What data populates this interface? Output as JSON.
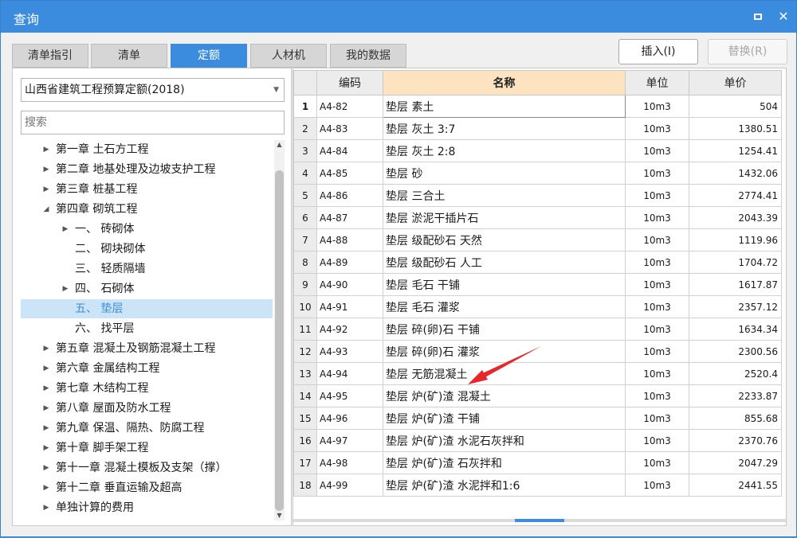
{
  "window": {
    "title": "查询",
    "maximize_label": "",
    "close_label": "✕"
  },
  "tabs": [
    {
      "label": "清单指引",
      "active": false
    },
    {
      "label": "清单",
      "active": false
    },
    {
      "label": "定额",
      "active": true
    },
    {
      "label": "人材机",
      "active": false
    },
    {
      "label": "我的数据",
      "active": false
    }
  ],
  "buttons": {
    "insert": "插入(I)",
    "replace": "替换(R)"
  },
  "left": {
    "dropdown_value": "山西省建筑工程预算定额(2018)",
    "search_placeholder": "搜索",
    "tree": [
      {
        "label": "第一章 土石方工程",
        "level": 0,
        "caret": "▶"
      },
      {
        "label": "第二章 地基处理及边坡支护工程",
        "level": 0,
        "caret": "▶"
      },
      {
        "label": "第三章 桩基工程",
        "level": 0,
        "caret": "▶"
      },
      {
        "label": "第四章 砌筑工程",
        "level": 0,
        "caret": "◢"
      },
      {
        "label": "一、 砖砌体",
        "level": 1,
        "caret": "▶"
      },
      {
        "label": "二、 砌块砌体",
        "level": 1,
        "caret": ""
      },
      {
        "label": "三、 轻质隔墙",
        "level": 1,
        "caret": ""
      },
      {
        "label": "四、 石砌体",
        "level": 1,
        "caret": "▶"
      },
      {
        "label": "五、 垫层",
        "level": 1,
        "caret": "",
        "selected": true
      },
      {
        "label": "六、 找平层",
        "level": 1,
        "caret": ""
      },
      {
        "label": "第五章 混凝土及钢筋混凝土工程",
        "level": 0,
        "caret": "▶"
      },
      {
        "label": "第六章 金属结构工程",
        "level": 0,
        "caret": "▶"
      },
      {
        "label": "第七章 木结构工程",
        "level": 0,
        "caret": "▶"
      },
      {
        "label": "第八章 屋面及防水工程",
        "level": 0,
        "caret": "▶"
      },
      {
        "label": "第九章 保温、隔热、防腐工程",
        "level": 0,
        "caret": "▶"
      },
      {
        "label": "第十章 脚手架工程",
        "level": 0,
        "caret": "▶"
      },
      {
        "label": "第十一章 混凝土模板及支架（撑）",
        "level": 0,
        "caret": "▶"
      },
      {
        "label": "第十二章 垂直运输及超高",
        "level": 0,
        "caret": "▶"
      },
      {
        "label": "单独计算的费用",
        "level": 0,
        "caret": "▶"
      }
    ]
  },
  "table": {
    "headers": {
      "code": "编码",
      "name": "名称",
      "unit": "单位",
      "price": "单价"
    },
    "rows": [
      {
        "idx": "1",
        "code": "A4-82",
        "name": "垫层 素土",
        "unit": "10m3",
        "price": "504"
      },
      {
        "idx": "2",
        "code": "A4-83",
        "name": "垫层 灰土 3:7",
        "unit": "10m3",
        "price": "1380.51"
      },
      {
        "idx": "3",
        "code": "A4-84",
        "name": "垫层 灰土 2:8",
        "unit": "10m3",
        "price": "1254.41"
      },
      {
        "idx": "4",
        "code": "A4-85",
        "name": "垫层 砂",
        "unit": "10m3",
        "price": "1432.06"
      },
      {
        "idx": "5",
        "code": "A4-86",
        "name": "垫层 三合土",
        "unit": "10m3",
        "price": "2774.41"
      },
      {
        "idx": "6",
        "code": "A4-87",
        "name": "垫层 淤泥干插片石",
        "unit": "10m3",
        "price": "2043.39"
      },
      {
        "idx": "7",
        "code": "A4-88",
        "name": "垫层 级配砂石 天然",
        "unit": "10m3",
        "price": "1119.96"
      },
      {
        "idx": "8",
        "code": "A4-89",
        "name": "垫层 级配砂石 人工",
        "unit": "10m3",
        "price": "1704.72"
      },
      {
        "idx": "9",
        "code": "A4-90",
        "name": "垫层 毛石 干铺",
        "unit": "10m3",
        "price": "1617.87"
      },
      {
        "idx": "10",
        "code": "A4-91",
        "name": "垫层 毛石 灌浆",
        "unit": "10m3",
        "price": "2357.12"
      },
      {
        "idx": "11",
        "code": "A4-92",
        "name": "垫层 碎(卵)石 干铺",
        "unit": "10m3",
        "price": "1634.34"
      },
      {
        "idx": "12",
        "code": "A4-93",
        "name": "垫层 碎(卵)石 灌浆",
        "unit": "10m3",
        "price": "2300.56"
      },
      {
        "idx": "13",
        "code": "A4-94",
        "name": "垫层 无筋混凝土",
        "unit": "10m3",
        "price": "2520.4"
      },
      {
        "idx": "14",
        "code": "A4-95",
        "name": "垫层 炉(矿)渣 混凝土",
        "unit": "10m3",
        "price": "2233.87"
      },
      {
        "idx": "15",
        "code": "A4-96",
        "name": "垫层 炉(矿)渣 干铺",
        "unit": "10m3",
        "price": "855.68"
      },
      {
        "idx": "16",
        "code": "A4-97",
        "name": "垫层 炉(矿)渣 水泥石灰拌和",
        "unit": "10m3",
        "price": "2370.76"
      },
      {
        "idx": "17",
        "code": "A4-98",
        "name": "垫层 炉(矿)渣 石灰拌和",
        "unit": "10m3",
        "price": "2047.29"
      },
      {
        "idx": "18",
        "code": "A4-99",
        "name": "垫层 炉(矿)渣 水泥拌和1:6",
        "unit": "10m3",
        "price": "2441.55"
      }
    ]
  },
  "colors": {
    "accent": "#3b8cde",
    "name_header": "#fde3c0",
    "selection": "#cce4f7",
    "annotation_arrow": "#e8262b"
  }
}
